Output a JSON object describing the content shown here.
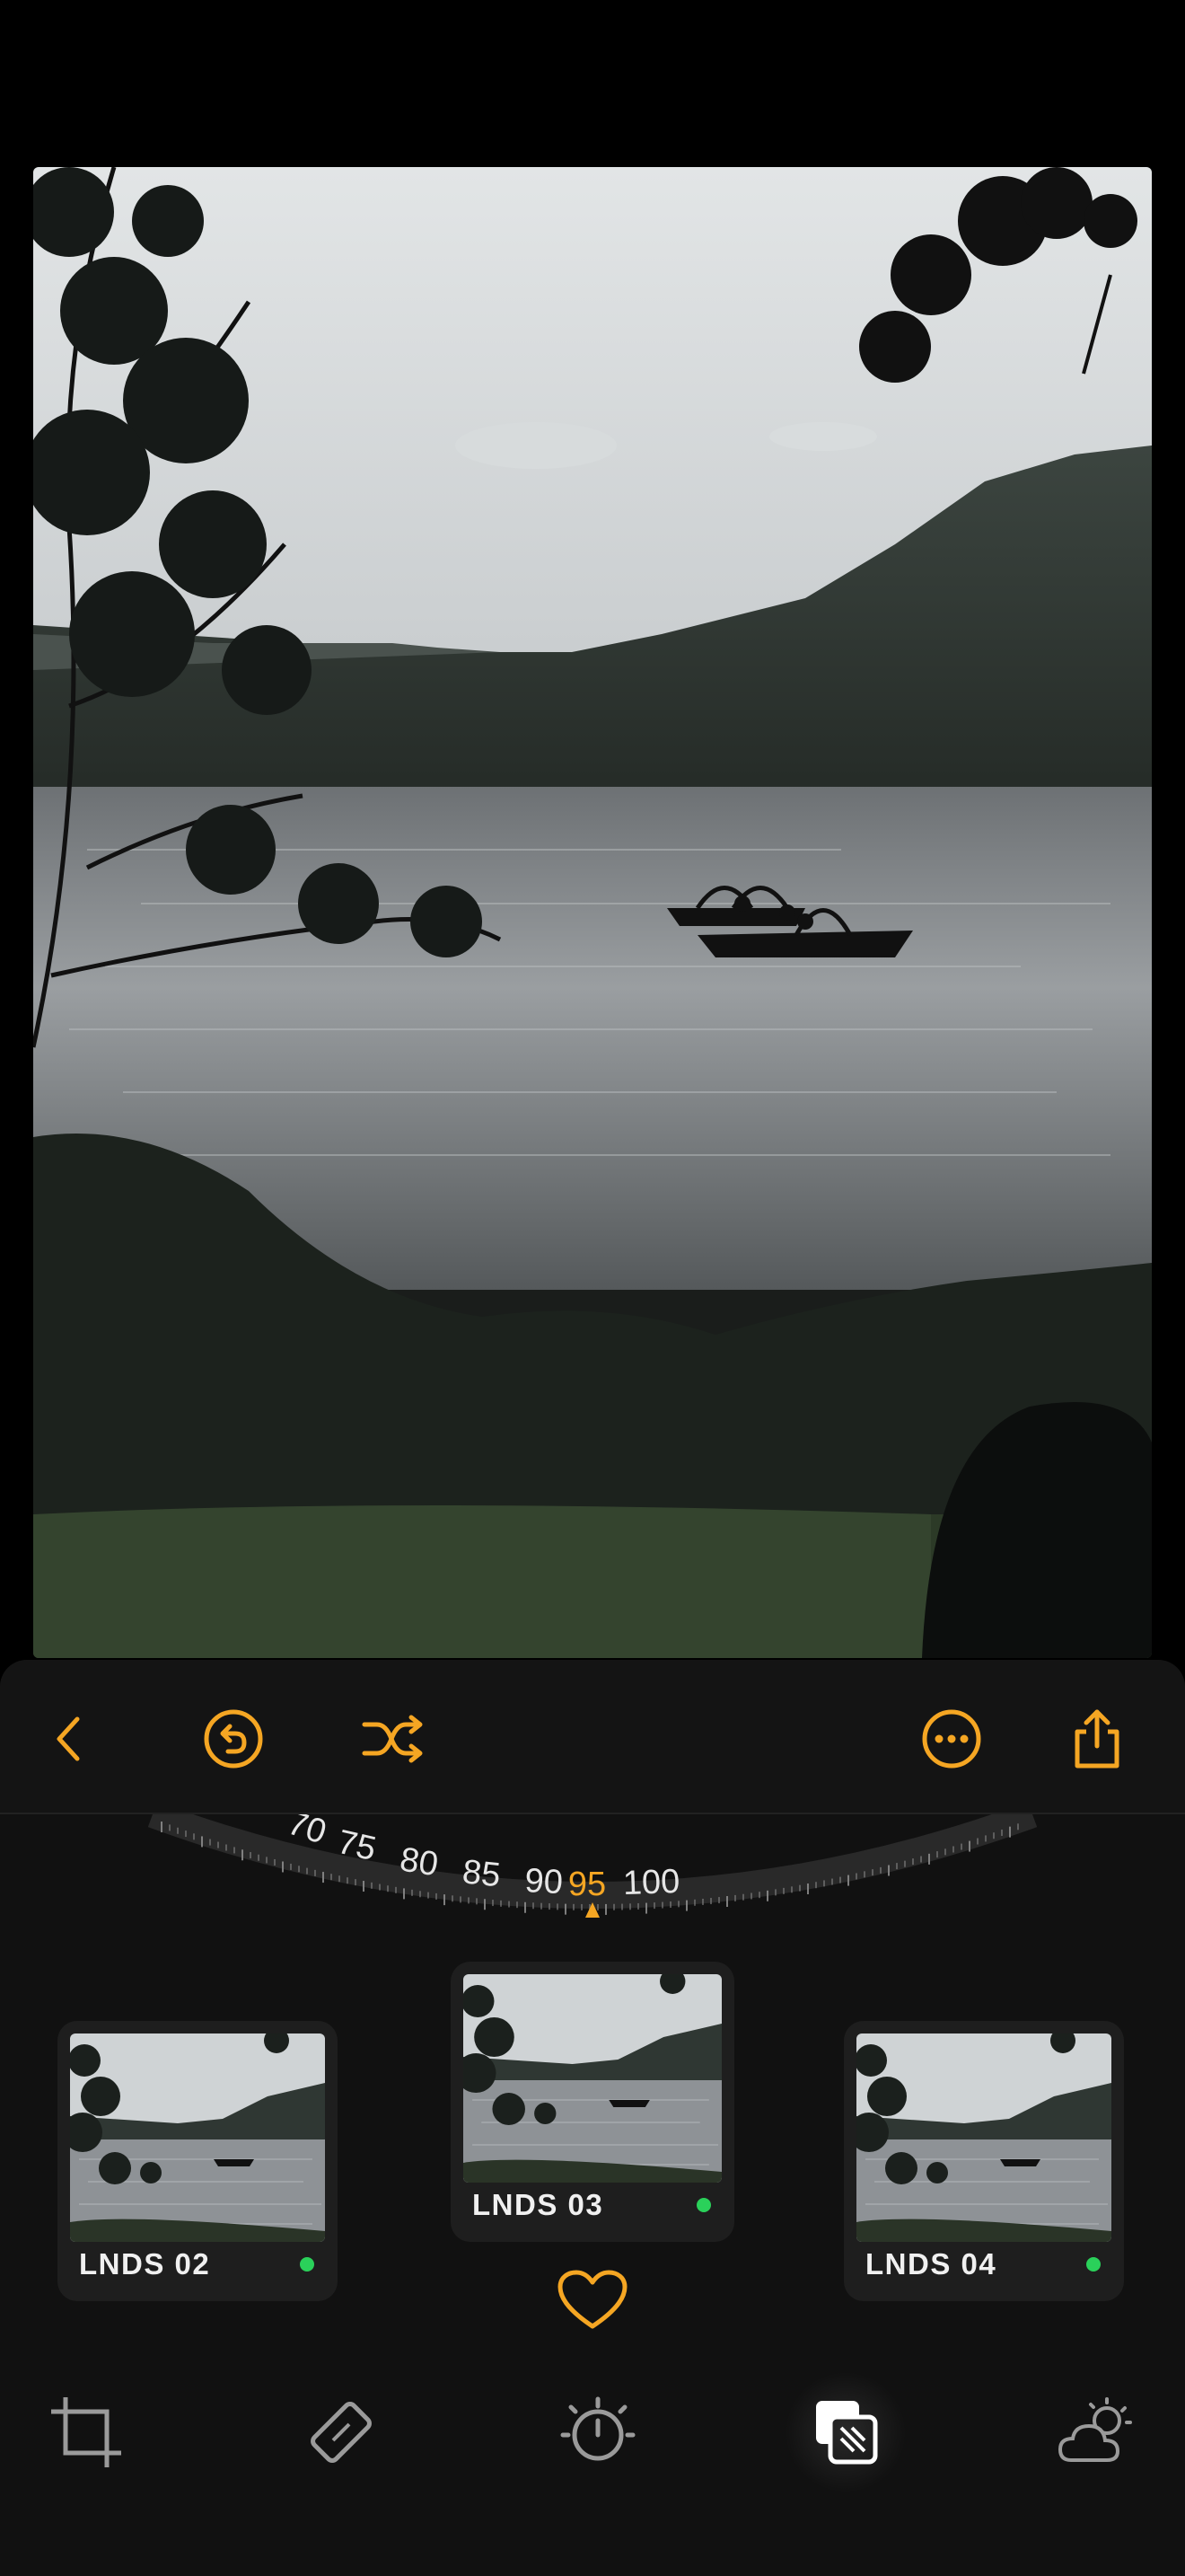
{
  "toolbar": {
    "back_icon": "chevron-left-icon",
    "undo_icon": "undo-circle-icon",
    "shuffle_icon": "shuffle-icon",
    "more_icon": "ellipsis-circle-icon",
    "share_icon": "share-icon"
  },
  "dial": {
    "labels": [
      "70",
      "75",
      "80",
      "85",
      "90",
      "95",
      "100"
    ],
    "value": 95
  },
  "presets": [
    {
      "label": "LNDS 02",
      "active": false,
      "status_color": "#2ad15a"
    },
    {
      "label": "LNDS 03",
      "active": true,
      "status_color": "#2ad15a"
    },
    {
      "label": "LNDS 04",
      "active": false,
      "status_color": "#2ad15a"
    }
  ],
  "favorite_icon": "heart-icon",
  "tabs": [
    {
      "name": "crop-icon",
      "active": false
    },
    {
      "name": "eraser-icon",
      "active": false
    },
    {
      "name": "timer-icon",
      "active": false
    },
    {
      "name": "presets-icon",
      "active": true
    },
    {
      "name": "weather-icon",
      "active": false
    }
  ],
  "colors": {
    "accent": "#f5a623",
    "status": "#2ad15a",
    "panel": "#111111"
  }
}
